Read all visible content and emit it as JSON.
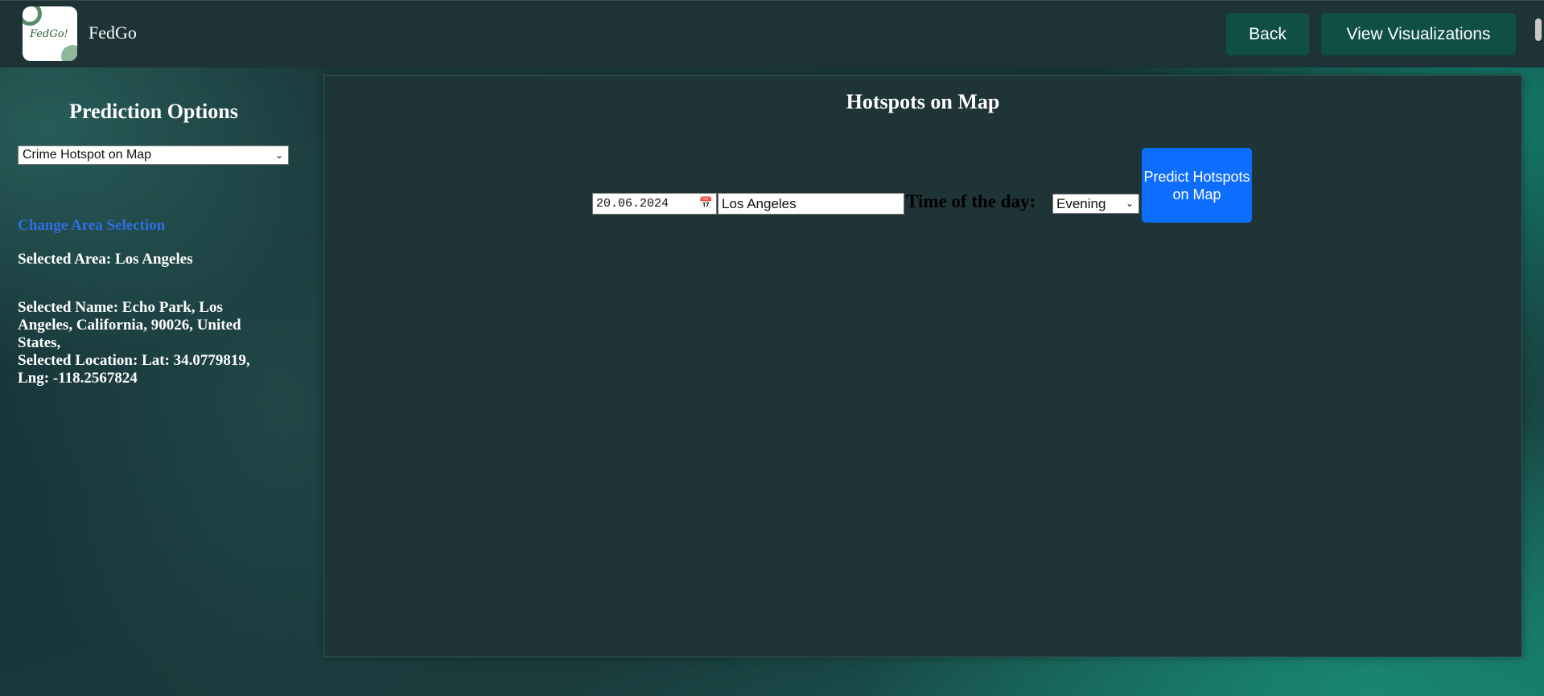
{
  "header": {
    "logo_text": "FedGo!",
    "brand": "FedGo",
    "back_label": "Back",
    "visualizations_label": "View Visualizations"
  },
  "sidebar": {
    "title": "Prediction Options",
    "prediction_select": "Crime Hotspot on Map",
    "change_area_link": "Change Area Selection",
    "selected_area": "Selected Area: Los Angeles",
    "selected_name": "Selected Name: Echo Park, Los Angeles, California, 90026, United States,",
    "selected_location": "Selected Location: Lat: 34.0779819, Lng: -118.2567824"
  },
  "panel": {
    "title": "Hotspots on Map",
    "date_value": "20.06.2024",
    "city_value": "Los Angeles",
    "time_label": "Time of the day:",
    "time_value": "Evening",
    "predict_label": "Predict Hotspots on Map"
  },
  "colors": {
    "topbar": "#1d3335",
    "top_button": "#0f4f46",
    "primary_button": "#0d6efd",
    "link": "#2f6fe0",
    "panel": "#1f3436"
  }
}
